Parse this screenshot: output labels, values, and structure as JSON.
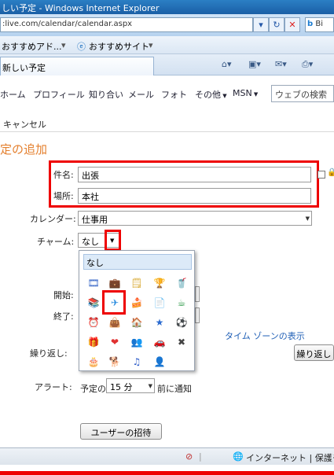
{
  "window": {
    "title": "しい予定 - Windows Internet Explorer",
    "address": ":live.com/calendar/calendar.aspx",
    "search_label": "Bi"
  },
  "favorites": {
    "item1": "おすすめアド...",
    "item2": "おすすめサイト"
  },
  "tab": {
    "label": "新しい予定"
  },
  "nav": {
    "items": [
      "ホーム",
      "プロフィール",
      "知り合い",
      "メール",
      "フォト",
      "その他",
      "MSN"
    ],
    "search_placeholder": "ウェブの検索"
  },
  "page": {
    "cancel": "キャンセル",
    "title": "定の追加"
  },
  "form": {
    "subject_label": "件名:",
    "subject_value": "出張",
    "location_label": "場所:",
    "location_value": "本社",
    "calendar_label": "カレンダー:",
    "calendar_value": "仕事用",
    "charm_label": "チャーム:",
    "charm_value": "なし",
    "start_label": "開始:",
    "end_label": "終了:",
    "timezone_link": "タイム ゾーンの表示",
    "repeat_label": "繰り返し:",
    "repeat_button": "繰り返し",
    "alert_label": "アラート:",
    "alert_prefix": "予定の",
    "alert_value": "15 分",
    "alert_suffix": "前に通知",
    "invite_button": "ユーザーの招待"
  },
  "charm_popup": {
    "none_label": "なし",
    "icons": [
      [
        "film-reel-icon",
        "🎞",
        "#3a68c8"
      ],
      [
        "briefcase-icon",
        "💼",
        "#c84a2a"
      ],
      [
        "document-icon",
        "🗒",
        "#d8a830"
      ],
      [
        "trophy-icon",
        "🏆",
        "#d9a520"
      ],
      [
        "cup-icon",
        "🥤",
        "#c43030"
      ],
      [
        "books-icon",
        "📚",
        "#3a7a3a"
      ],
      [
        "airplane-icon",
        "✈",
        "#2e8ee0"
      ],
      [
        "cake-slice-icon",
        "🍰",
        "#d9a030"
      ],
      [
        "note-icon",
        "📄",
        "#7090b0"
      ],
      [
        "mug-icon",
        "☕",
        "#2f9a4a"
      ],
      [
        "clock-icon",
        "⏰",
        "#2a78c8"
      ],
      [
        "shopping-bag-icon",
        "👜",
        "#e0b020"
      ],
      [
        "house-icon",
        "🏠",
        "#b84a2a"
      ],
      [
        "star-icon",
        "★",
        "#2a6ad0"
      ],
      [
        "soccer-ball-icon",
        "⚽",
        "#222222"
      ],
      [
        "gift-icon",
        "🎁",
        "#c0a060"
      ],
      [
        "heart-icon",
        "❤",
        "#e03030"
      ],
      [
        "people-icon",
        "👥",
        "#c05a2a"
      ],
      [
        "car-icon",
        "🚗",
        "#c83030"
      ],
      [
        "tools-icon",
        "✖",
        "#444444"
      ],
      [
        "birthday-cake-icon",
        "🎂",
        "#c08a30"
      ],
      [
        "dog-icon",
        "🐕",
        "#8a5a2a"
      ],
      [
        "music-note-icon",
        "♫",
        "#2a5ac8"
      ],
      [
        "person-icon",
        "👤",
        "#8a6a3a"
      ]
    ]
  },
  "status": {
    "zone": "インターネット | 保護モ"
  }
}
